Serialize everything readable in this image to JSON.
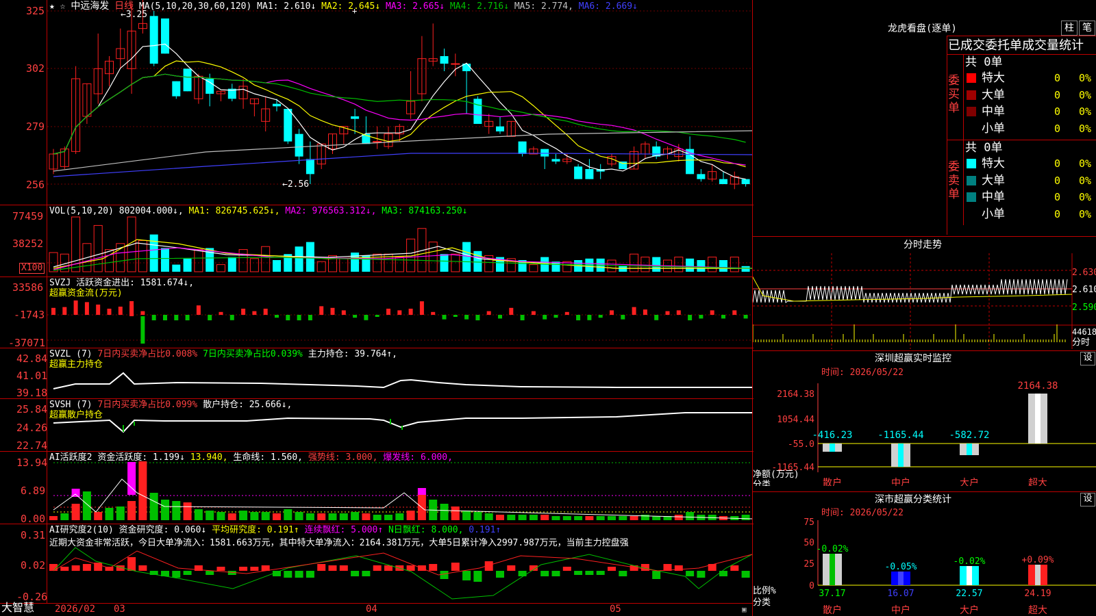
{
  "colors": {
    "up": "#ff2020",
    "down": "#00ffff",
    "grid": "#c00000",
    "axis": "#ff4040",
    "white": "#ffffff",
    "yellow": "#ffff00",
    "magenta": "#ff00ff",
    "green": "#00c000",
    "blue": "#4040ff"
  },
  "main_chart": {
    "stock_name": "中远海发",
    "period": "日线",
    "ma_header": "MA(5,10,20,30,60,120)",
    "ma_values": [
      {
        "label": "MA1:",
        "value": "2.610↓",
        "color": "#ffffff"
      },
      {
        "label": "MA2:",
        "value": "2.645↓",
        "color": "#ffff00"
      },
      {
        "label": "MA3:",
        "value": "2.665↓",
        "color": "#ff00ff"
      },
      {
        "label": "MA4:",
        "value": "2.716↓",
        "color": "#00c000"
      },
      {
        "label": "MA5:",
        "value": "2.774,",
        "color": "#c0c0c0"
      },
      {
        "label": "MA6:",
        "value": "2.669↓",
        "color": "#4040ff"
      }
    ],
    "y_ticks": [
      "325",
      "302",
      "279",
      "256"
    ],
    "high_mark": "3.25",
    "low_mark": "2.56"
  },
  "vol_panel": {
    "header": "VOL(5,10,20)",
    "value": "802004.000↓,",
    "ma1": "MA1: 826745.625↓,",
    "ma2": "MA2: 976563.312↓,",
    "ma3": "MA3: 874163.250↓",
    "y_ticks": [
      "77459",
      "38252"
    ],
    "unit": "X100"
  },
  "svzj_panel": {
    "header": "SVZJ",
    "label": "活跃资金进出:",
    "value": "1581.674↓,",
    "title": "超赢资金流(万元)",
    "y_ticks": [
      "33586",
      "-1743",
      "-37071"
    ]
  },
  "svzl_panel": {
    "header": "SVZL (7)",
    "a": "7日内买卖净占比0.008%",
    "b": "7日内买卖净占比0.039%",
    "c": "主力持仓: 39.764↑,",
    "title": "超赢主力持仓",
    "y_ticks": [
      "42.84",
      "41.01",
      "39.18"
    ]
  },
  "svsh_panel": {
    "header": "SVSH (7)",
    "a": "7日内买卖净占比0.099%",
    "c": "散户持仓: 25.666↓,",
    "title": "超赢散户持仓",
    "y_ticks": [
      "25.84",
      "24.26",
      "22.74"
    ]
  },
  "ai_active": {
    "header": "AI活跃度2",
    "a": "资金活跃度: 1.199↓",
    "b": "13.940,",
    "c": "生命线: 1.560,",
    "d": "强势线: 3.000,",
    "e": "爆发线: 6.000,",
    "y_ticks": [
      "13.94",
      "6.89",
      "0.00"
    ]
  },
  "ai_research": {
    "header": "AI研究度2(10)",
    "a": "资金研究度: 0.060↓",
    "b": "平均研究度: 0.191↑",
    "c": "连续飘红: 5.000↑",
    "d": "N日飘红: 8.000,",
    "e": "0.191↑",
    "note": "近期大资金非常活跃，今日大单净流入：1581.663万元，其中特大单净流入：2164.381万元，大单5日累计净入2997.987万元，当前主力控盘强",
    "y_ticks": [
      "0.31",
      "0.02",
      "-0.26"
    ]
  },
  "x_axis": {
    "labels": [
      "2026/02",
      "03",
      "04",
      "05"
    ]
  },
  "brand": "大智慧",
  "right": {
    "lhb_title": "龙虎看盘(逐单)",
    "btn_zhu": "柱",
    "btn_bi": "笔",
    "stats_title": "已成交委托单成交量统计",
    "buy_side": {
      "vlabel": "委买单",
      "total": "共 0单",
      "rows": [
        {
          "name": "特大",
          "v": "0",
          "p": "0%"
        },
        {
          "name": "大单",
          "v": "0",
          "p": "0%"
        },
        {
          "name": "中单",
          "v": "0",
          "p": "0%"
        },
        {
          "name": "小单",
          "v": "0",
          "p": "0%"
        }
      ]
    },
    "sell_side": {
      "vlabel": "委卖单",
      "total": "共 0单",
      "rows": [
        {
          "name": "特大",
          "v": "0",
          "p": "0%"
        },
        {
          "name": "大单",
          "v": "0",
          "p": "0%"
        },
        {
          "name": "中单",
          "v": "0",
          "p": "0%"
        },
        {
          "name": "小单",
          "v": "0",
          "p": "0%"
        }
      ]
    },
    "intraday": {
      "title": "分时走势",
      "y_ticks": [
        "2.630",
        "2.610",
        "2.590"
      ],
      "vol_tick": "44618",
      "vol_label": "分时"
    },
    "sz_monitor": {
      "title": "深圳超赢实时监控",
      "btn": "设",
      "time": "时间: 2026/05/22",
      "y_ticks": [
        "2164.38",
        "1054.44",
        "-55.0",
        "-1165.44"
      ],
      "ylabel": "净额(万元)",
      "xlabel": "分类",
      "categories": [
        "散户",
        "中户",
        "大户",
        "超大"
      ],
      "values": [
        "-416.23",
        "-1165.44",
        "-582.72",
        "2164.38"
      ]
    },
    "sz_class": {
      "title": "深市超赢分类统计",
      "btn": "设",
      "time": "时间: 2026/05/22",
      "y_ticks": [
        "75",
        "50",
        "25",
        "0"
      ],
      "ylabel": "比例%",
      "xlabel": "分类",
      "categories": [
        "散户",
        "中户",
        "大户",
        "超大"
      ],
      "top": [
        "-0.02%",
        "-0.05%",
        "-0.02%",
        "+0.09%"
      ],
      "bottom": [
        "37.17",
        "16.07",
        "22.57",
        "24.19"
      ]
    }
  }
}
